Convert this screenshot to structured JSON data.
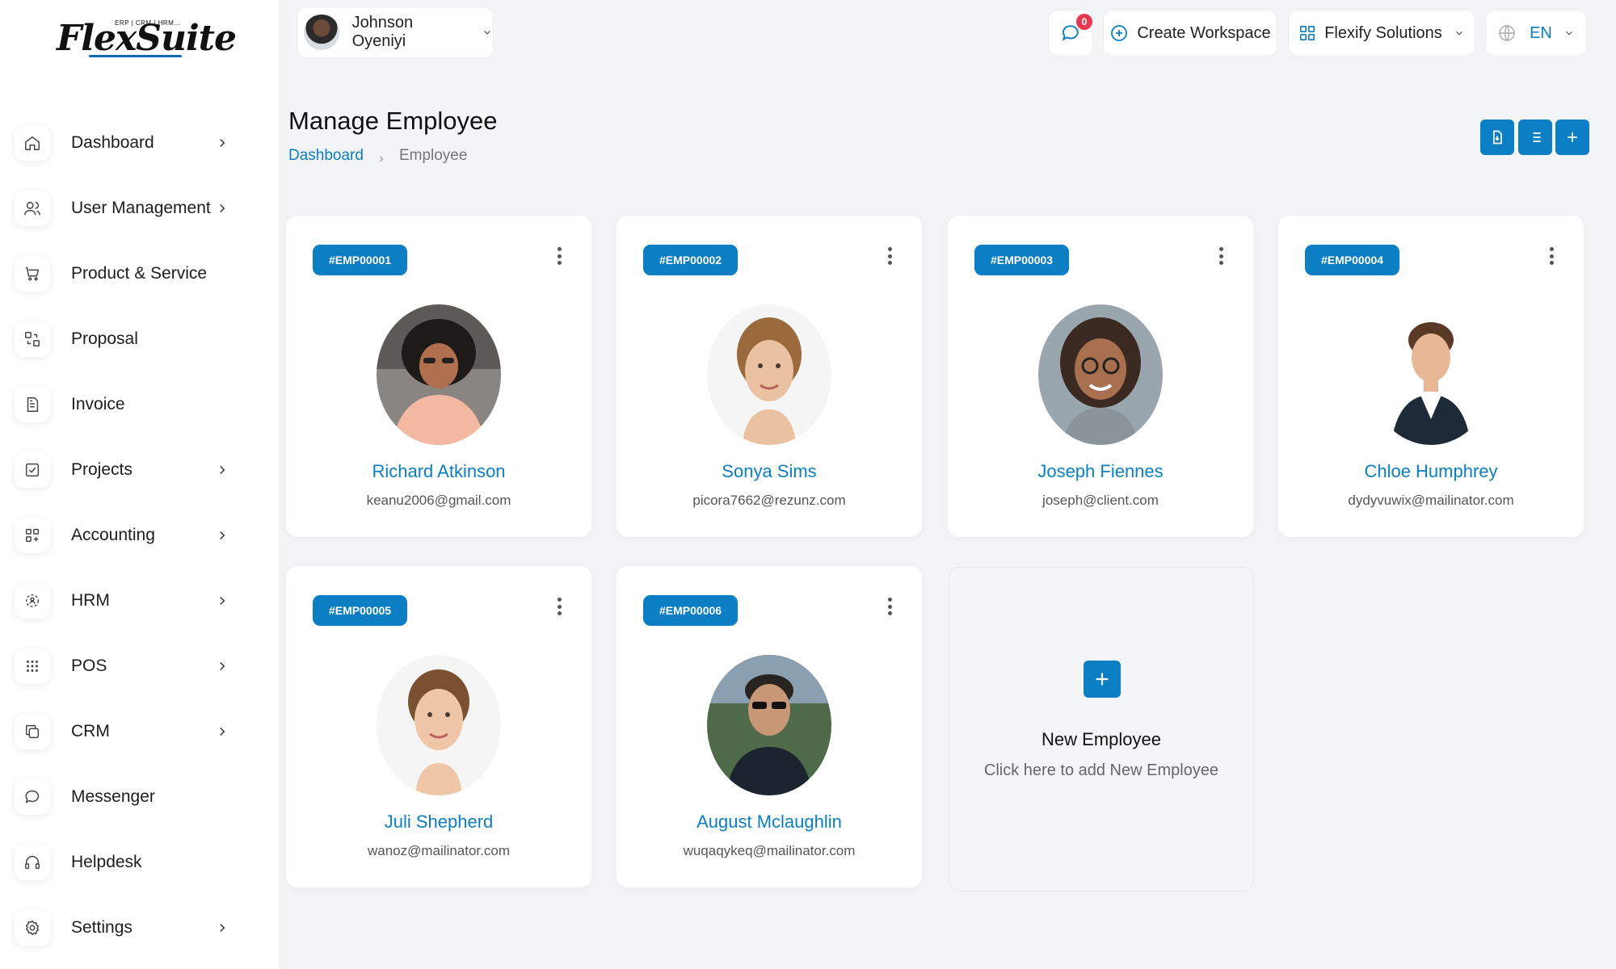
{
  "brand": {
    "logo_text": "FlexSuite",
    "logo_tagline": "ERP | CRM | HRM..."
  },
  "sidebar": {
    "items": [
      {
        "label": "Dashboard",
        "icon": "home-icon",
        "has_submenu": true
      },
      {
        "label": "User Management",
        "icon": "users-icon",
        "has_submenu": true
      },
      {
        "label": "Product & Service",
        "icon": "cart-icon",
        "has_submenu": false
      },
      {
        "label": "Proposal",
        "icon": "exchange-icon",
        "has_submenu": false
      },
      {
        "label": "Invoice",
        "icon": "file-invoice-icon",
        "has_submenu": false
      },
      {
        "label": "Projects",
        "icon": "checkbox-icon",
        "has_submenu": true
      },
      {
        "label": "Accounting",
        "icon": "grid-plus-icon",
        "has_submenu": true
      },
      {
        "label": "HRM",
        "icon": "hrm-icon",
        "has_submenu": true
      },
      {
        "label": "POS",
        "icon": "dots-grid-icon",
        "has_submenu": true
      },
      {
        "label": "CRM",
        "icon": "copy-icon",
        "has_submenu": true
      },
      {
        "label": "Messenger",
        "icon": "message-icon",
        "has_submenu": false
      },
      {
        "label": "Helpdesk",
        "icon": "headphones-icon",
        "has_submenu": false
      },
      {
        "label": "Settings",
        "icon": "gear-icon",
        "has_submenu": true
      }
    ]
  },
  "topbar": {
    "user_name": "Johnson Oyeniyi",
    "message_count": "0",
    "create_workspace_label": "Create Workspace",
    "company_label": "Flexify Solutions",
    "language_label": "EN"
  },
  "page": {
    "title": "Manage Employee",
    "breadcrumb": {
      "parent": "Dashboard",
      "current": "Employee"
    }
  },
  "employees": [
    {
      "id": "#EMP00001",
      "name": "Richard Atkinson",
      "email": "keanu2006@gmail.com"
    },
    {
      "id": "#EMP00002",
      "name": "Sonya Sims",
      "email": "picora7662@rezunz.com"
    },
    {
      "id": "#EMP00003",
      "name": "Joseph Fiennes",
      "email": "joseph@client.com"
    },
    {
      "id": "#EMP00004",
      "name": "Chloe Humphrey",
      "email": "dydyvuwix@mailinator.com"
    },
    {
      "id": "#EMP00005",
      "name": "Juli Shepherd",
      "email": "wanoz@mailinator.com"
    },
    {
      "id": "#EMP00006",
      "name": "August Mclaughlin",
      "email": "wuqaqykeq@mailinator.com"
    }
  ],
  "new_employee": {
    "title": "New Employee",
    "subtitle": "Click here to add New Employee"
  },
  "colors": {
    "accent": "#0b7ec4",
    "badge": "#e53950",
    "background": "#f3f4f6"
  }
}
